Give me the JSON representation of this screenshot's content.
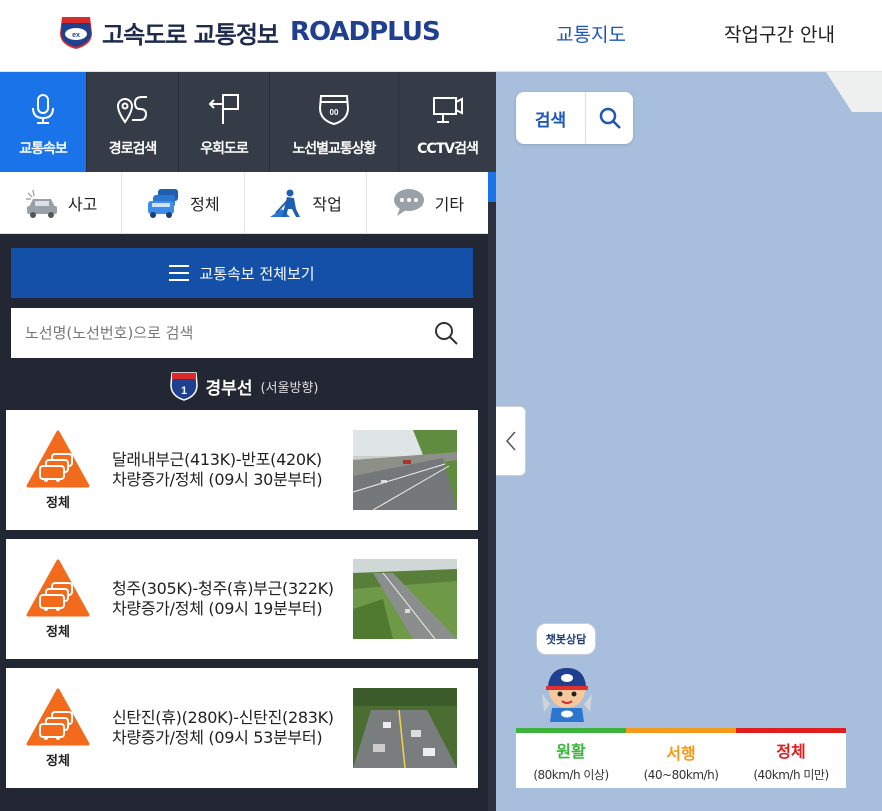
{
  "header": {
    "logo_text": "고속도로 교통정보",
    "logo_brand": "ROADPLUS",
    "nav": [
      {
        "label": "교통지도",
        "active": true
      },
      {
        "label": "작업구간 안내",
        "active": false
      }
    ]
  },
  "main_tabs": [
    {
      "label": "교통속보",
      "icon": "microphone-icon",
      "active": true
    },
    {
      "label": "경로검색",
      "icon": "route-pin-icon",
      "active": false
    },
    {
      "label": "우회도로",
      "icon": "detour-sign-icon",
      "active": false
    },
    {
      "label": "노선별교통상황",
      "icon": "highway-shield-icon",
      "active": false
    },
    {
      "label": "CCTV검색",
      "icon": "cctv-camera-icon",
      "active": false
    }
  ],
  "sub_tabs": [
    {
      "label": "사고",
      "icon": "crashed-car-icon"
    },
    {
      "label": "정체",
      "icon": "congestion-cars-icon"
    },
    {
      "label": "작업",
      "icon": "road-worker-icon"
    },
    {
      "label": "기타",
      "icon": "speech-bubble-icon"
    }
  ],
  "view_all_label": "교통속보 전체보기",
  "search": {
    "placeholder": "노선명(노선번호)으로 검색",
    "value": ""
  },
  "route": {
    "number": "1",
    "name": "경부선",
    "direction": "(서울방향)"
  },
  "incidents": [
    {
      "type": "정체",
      "location": "달래내부근(413K)-반포(420K)",
      "detail": "차량증가/정체 (09시 30분부터)"
    },
    {
      "type": "정체",
      "location": "청주(305K)-청주(휴)부근(322K)",
      "detail": "차량증가/정체 (09시 19분부터)"
    },
    {
      "type": "정체",
      "location": "신탄진(휴)(280K)-신탄진(283K)",
      "detail": "차량증가/정체 (09시 53분부터)"
    }
  ],
  "map": {
    "search_label": "검색",
    "chatbot_label": "챗봇상담"
  },
  "legend": [
    {
      "title": "원활",
      "range": "(80km/h 이상)",
      "color": "#3cb43c"
    },
    {
      "title": "서행",
      "range": "(40~80km/h)",
      "color": "#f59a1a"
    },
    {
      "title": "정체",
      "range": "(40km/h 미만)",
      "color": "#e01e1e"
    }
  ],
  "colors": {
    "accent": "#1a73e8",
    "panel": "#222733",
    "map": "#a7bfdc",
    "incident": "#f26b1d"
  }
}
